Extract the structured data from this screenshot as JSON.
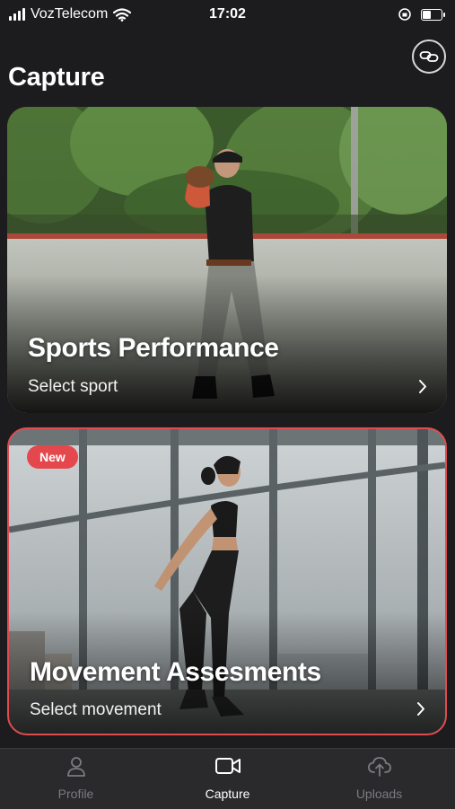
{
  "status_bar": {
    "carrier": "VozTelecom",
    "time": "17:02"
  },
  "header": {
    "title": "Capture",
    "link_icon": "link-icon"
  },
  "cards": [
    {
      "title": "Sports Performance",
      "subtitle": "Select sport",
      "image": "baseball-player-photo"
    },
    {
      "badge": "New",
      "title": "Movement Assesments",
      "subtitle": "Select movement",
      "image": "woman-jumping-photo",
      "accent_color": "#e04b4f"
    }
  ],
  "tab_bar": {
    "tabs": [
      {
        "label": "Profile",
        "icon": "person-icon",
        "active": false
      },
      {
        "label": "Capture",
        "icon": "video-camera-icon",
        "active": true
      },
      {
        "label": "Uploads",
        "icon": "cloud-upload-icon",
        "active": false
      }
    ]
  },
  "colors": {
    "background": "#1c1c1e",
    "accent": "#e4484d",
    "tab_inactive": "#7b7b80"
  }
}
